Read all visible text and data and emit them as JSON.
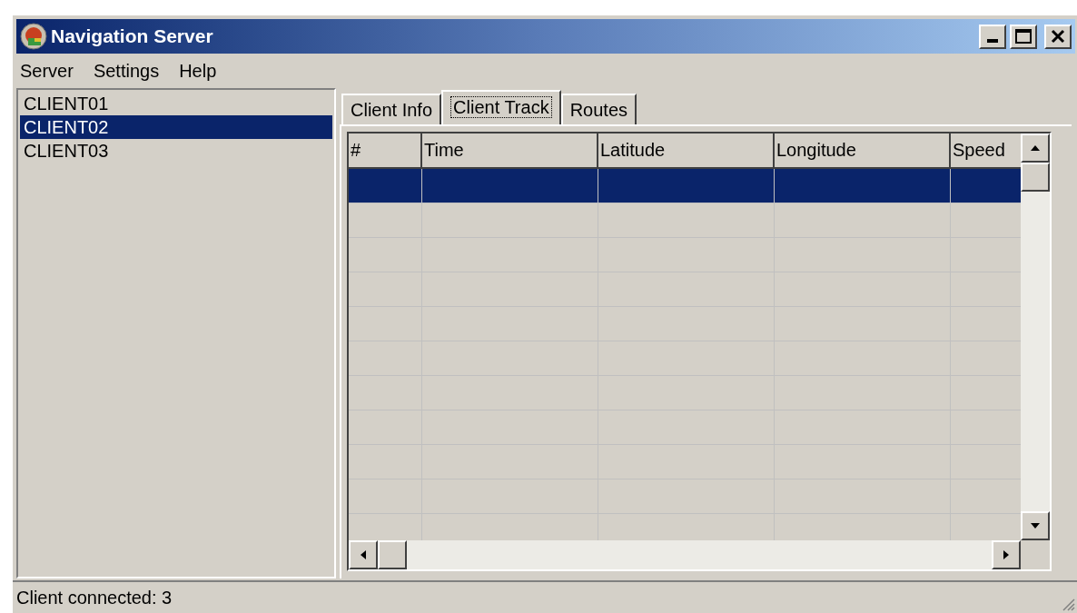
{
  "window": {
    "title": "Navigation Server"
  },
  "menu": [
    {
      "label": "Server"
    },
    {
      "label": "Settings"
    },
    {
      "label": "Help"
    }
  ],
  "clients": [
    {
      "label": "CLIENT01",
      "selected": false
    },
    {
      "label": "CLIENT02",
      "selected": true
    },
    {
      "label": "CLIENT03",
      "selected": false
    }
  ],
  "tabs": [
    {
      "label": "Client Info",
      "selected": false
    },
    {
      "label": "Client Track",
      "selected": true
    },
    {
      "label": "Routes",
      "selected": false
    }
  ],
  "table": {
    "columns": [
      "#",
      "Time",
      "Latitude",
      "Longitude",
      "Speed"
    ],
    "rows": [
      {
        "selected": true
      },
      {
        "selected": false
      },
      {
        "selected": false
      },
      {
        "selected": false
      },
      {
        "selected": false
      },
      {
        "selected": false
      },
      {
        "selected": false
      },
      {
        "selected": false
      },
      {
        "selected": false
      },
      {
        "selected": false
      },
      {
        "selected": false
      }
    ]
  },
  "status_bar": {
    "text": "Client connected: 3"
  }
}
